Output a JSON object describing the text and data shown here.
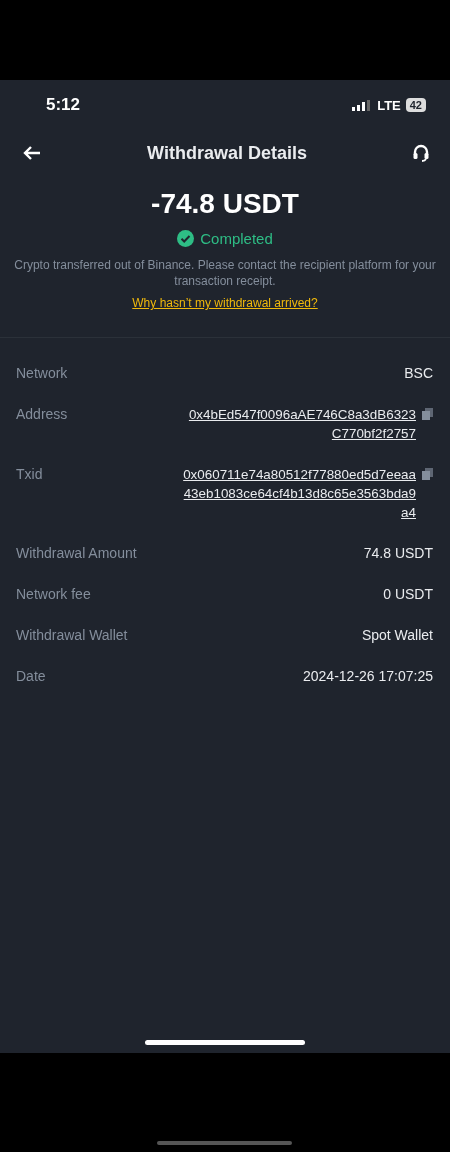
{
  "status_bar": {
    "time": "5:12",
    "network": "LTE",
    "battery": "42"
  },
  "header": {
    "title": "Withdrawal Details"
  },
  "summary": {
    "amount": "-74.8 USDT",
    "status": "Completed",
    "note": "Crypto transferred out of Binance. Please contact the recipient platform for your transaction receipt.",
    "help_link": "Why hasn’t my withdrawal arrived?"
  },
  "details": [
    {
      "label": "Network",
      "value": "BSC",
      "kind": "text"
    },
    {
      "label": "Address",
      "value": "0x4bEd547f0096aAE746C8a3dB6323C770bf2f2757",
      "kind": "hash"
    },
    {
      "label": "Txid",
      "value": "0x060711e74a80512f77880ed5d7eeaa43eb1083ce64cf4b13d8c65e3563bda9a4",
      "kind": "hash"
    },
    {
      "label": "Withdrawal Amount",
      "value": "74.8 USDT",
      "kind": "text"
    },
    {
      "label": "Network fee",
      "value": "0 USDT",
      "kind": "text"
    },
    {
      "label": "Withdrawal Wallet",
      "value": "Spot Wallet",
      "kind": "text"
    },
    {
      "label": "Date",
      "value": "2024-12-26 17:07:25",
      "kind": "text"
    }
  ]
}
